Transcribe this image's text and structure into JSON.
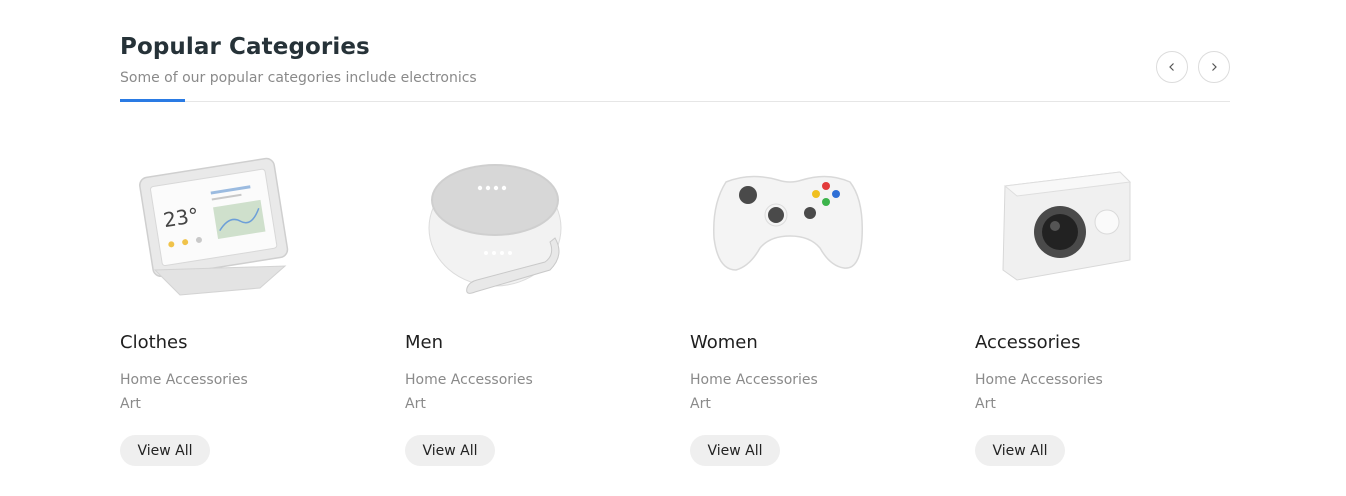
{
  "section": {
    "title": "Popular Categories",
    "subtitle": "Some of our popular categories include electronics",
    "accent_color": "#2a7be4"
  },
  "navigation": {
    "prev_icon": "chevron-left-icon",
    "next_icon": "chevron-right-icon"
  },
  "categories": [
    {
      "name": "Clothes",
      "image": "smart-display-image",
      "links": [
        "Home Accessories",
        "Art"
      ],
      "button": "View All"
    },
    {
      "name": "Men",
      "image": "smart-speaker-image",
      "links": [
        "Home Accessories",
        "Art"
      ],
      "button": "View All"
    },
    {
      "name": "Women",
      "image": "game-controller-image",
      "links": [
        "Home Accessories",
        "Art"
      ],
      "button": "View All"
    },
    {
      "name": "Accessories",
      "image": "action-camera-image",
      "links": [
        "Home Accessories",
        "Art"
      ],
      "button": "View All"
    }
  ],
  "display": {
    "time_temp": "23°"
  }
}
